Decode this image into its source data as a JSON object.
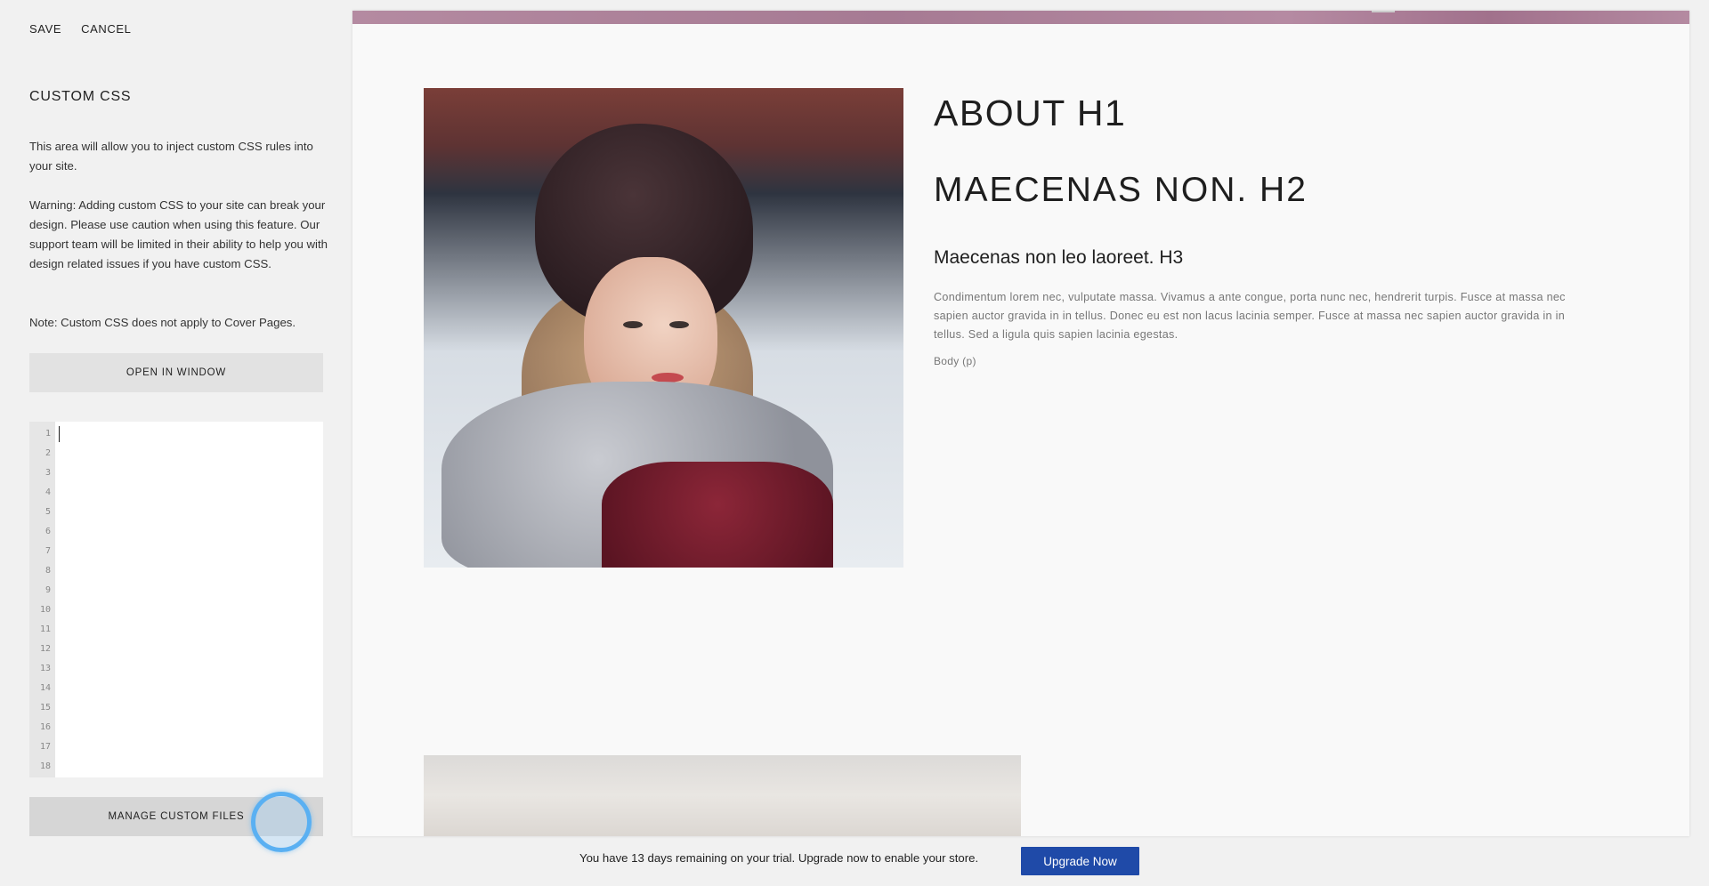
{
  "sidebar": {
    "save_label": "SAVE",
    "cancel_label": "CANCEL",
    "title": "CUSTOM CSS",
    "description": "This area will allow you to inject custom CSS rules into your site.",
    "warning": "Warning: Adding custom CSS to your site can break your design. Please use caution when using this feature. Our support team will be limited in their ability to help you with design related issues if you have custom CSS.",
    "note": "Note: Custom CSS does not apply to Cover Pages.",
    "open_window_label": "OPEN IN WINDOW",
    "manage_files_label": "MANAGE CUSTOM FILES",
    "line_numbers": [
      "1",
      "2",
      "3",
      "4",
      "5",
      "6",
      "7",
      "8",
      "9",
      "10",
      "11",
      "12",
      "13",
      "14",
      "15",
      "16",
      "17",
      "18"
    ]
  },
  "preview": {
    "h1": "ABOUT H1",
    "h2": "MAECENAS NON. H2",
    "h3": "Maecenas non leo laoreet. H3",
    "paragraph": "Condimentum lorem nec, vulputate massa. Vivamus a ante congue, porta nunc nec, hendrerit turpis. Fusce at massa nec sapien auctor gravida in in tellus. Donec eu est non lacus lacinia semper. Fusce at massa nec sapien auctor gravida in in tellus. Sed a ligula quis sapien lacinia egestas.",
    "body_label": "Body (p)"
  },
  "trial": {
    "message": "You have 13 days remaining on your trial. Upgrade now to enable your store.",
    "upgrade_label": "Upgrade Now"
  },
  "colors": {
    "accent_blue": "#1f4aa8",
    "strip_mauve": "#b48aa1",
    "click_ring": "#5ab0f2"
  }
}
